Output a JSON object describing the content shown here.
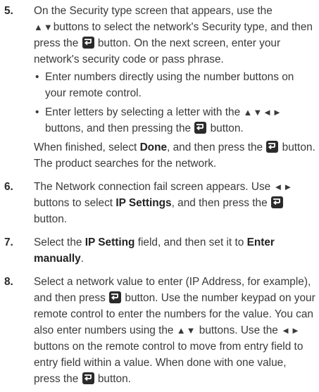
{
  "enter_icon": "enter-button-icon",
  "arrows": {
    "updown": "▲▼",
    "leftright": "◄►",
    "all": "▲▼◄►"
  },
  "steps": [
    {
      "num": "5.",
      "p1_a": "On the Security type screen that appears, use the ",
      "p1_b": "buttons to select the network's Security type, and then press the ",
      "p1_c": " button. On the next screen, enter your network's security code or pass phrase.",
      "bullets": [
        {
          "a": "Enter numbers directly using the number buttons on your remote control."
        },
        {
          "a": "Enter letters by selecting a letter with the ",
          "b": " buttons, and then pressing the ",
          "c": " button."
        }
      ],
      "p2_a": "When finished, select ",
      "p2_bold": "Done",
      "p2_b": ", and then press the ",
      "p2_c": " button. The product searches for the network."
    },
    {
      "num": "6.",
      "a": "The Network connection fail screen appears. Use ",
      "b": " buttons to select ",
      "bold": "IP Settings",
      "c": ", and then press the ",
      "d": " button."
    },
    {
      "num": "7.",
      "a": "Select the ",
      "bold1": "IP Setting",
      "b": " field, and then set it to ",
      "bold2": "Enter manually",
      "c": "."
    },
    {
      "num": "8.",
      "a": "Select a network value to enter (IP Address, for example), and then press ",
      "b": " button. Use the number keypad on your remote control to enter the numbers for the value. You can also enter numbers using the ",
      "c": " buttons. Use the ",
      "d": " buttons on the remote control to move from entry field to entry field within a value. When done with one value, press the ",
      "e": " button."
    }
  ]
}
